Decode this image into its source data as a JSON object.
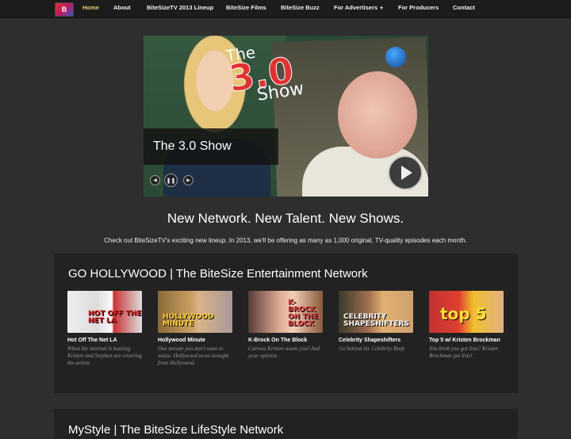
{
  "nav": {
    "logo": "B",
    "items": [
      {
        "label": "Home",
        "active": true
      },
      {
        "label": "About"
      },
      {
        "label": "BiteSizeTV 2013 Lineup"
      },
      {
        "label": "BiteSize Films"
      },
      {
        "label": "BiteSize Buzz"
      },
      {
        "label": "For Advertisers"
      },
      {
        "label": "For Producers"
      },
      {
        "label": "Contact"
      }
    ]
  },
  "hero": {
    "caption": "The 3.0 Show",
    "logo_the": "The",
    "logo_num": "3.0",
    "logo_show": "Show"
  },
  "tagline": "New Network. New Talent. New Shows.",
  "subline": "Check out BiteSizeTV's exciting new lineup. In 2013, we'll be offering as many as 1,000 original, TV-quality episodes each month.",
  "sections": [
    {
      "title": "GO HOLLYWOOD | The BiteSize Entertainment Network",
      "cards": [
        {
          "title": "Hot Off The Net LA",
          "desc": "When the internet is buzzing Kristen and Stephen are covering the action",
          "thumb_text": "HOT OFF THE NET LA"
        },
        {
          "title": "Hollywood Minute",
          "desc": "One minute you don't want to waste. Hollywood news straight from Hollywood.",
          "thumb_text": "HOLLYWOOD MINUTE"
        },
        {
          "title": "K-Brock On The Block",
          "desc": "Curious Kristen wants you! And your opinion.",
          "thumb_text": "K-BROCK ON THE BLOCK"
        },
        {
          "title": "Celebrity Shapeshifters",
          "desc": "Go behind the Celebrity Body",
          "thumb_text": "CELEBRITY SHAPESHIFTERS"
        },
        {
          "title": "Top 5 w/ Kristen Brockman",
          "desc": "You think you got lists? Kristen Brockman got lists!",
          "thumb_text": "top 5"
        }
      ]
    },
    {
      "title": "MyStyle | The BiteSize LifeStyle Network"
    }
  ],
  "colors": {
    "background": "#2e2e2e",
    "nav_bg": "#1c1c1c",
    "nav_active": "#e8c76a",
    "section_bg": "#222222"
  }
}
